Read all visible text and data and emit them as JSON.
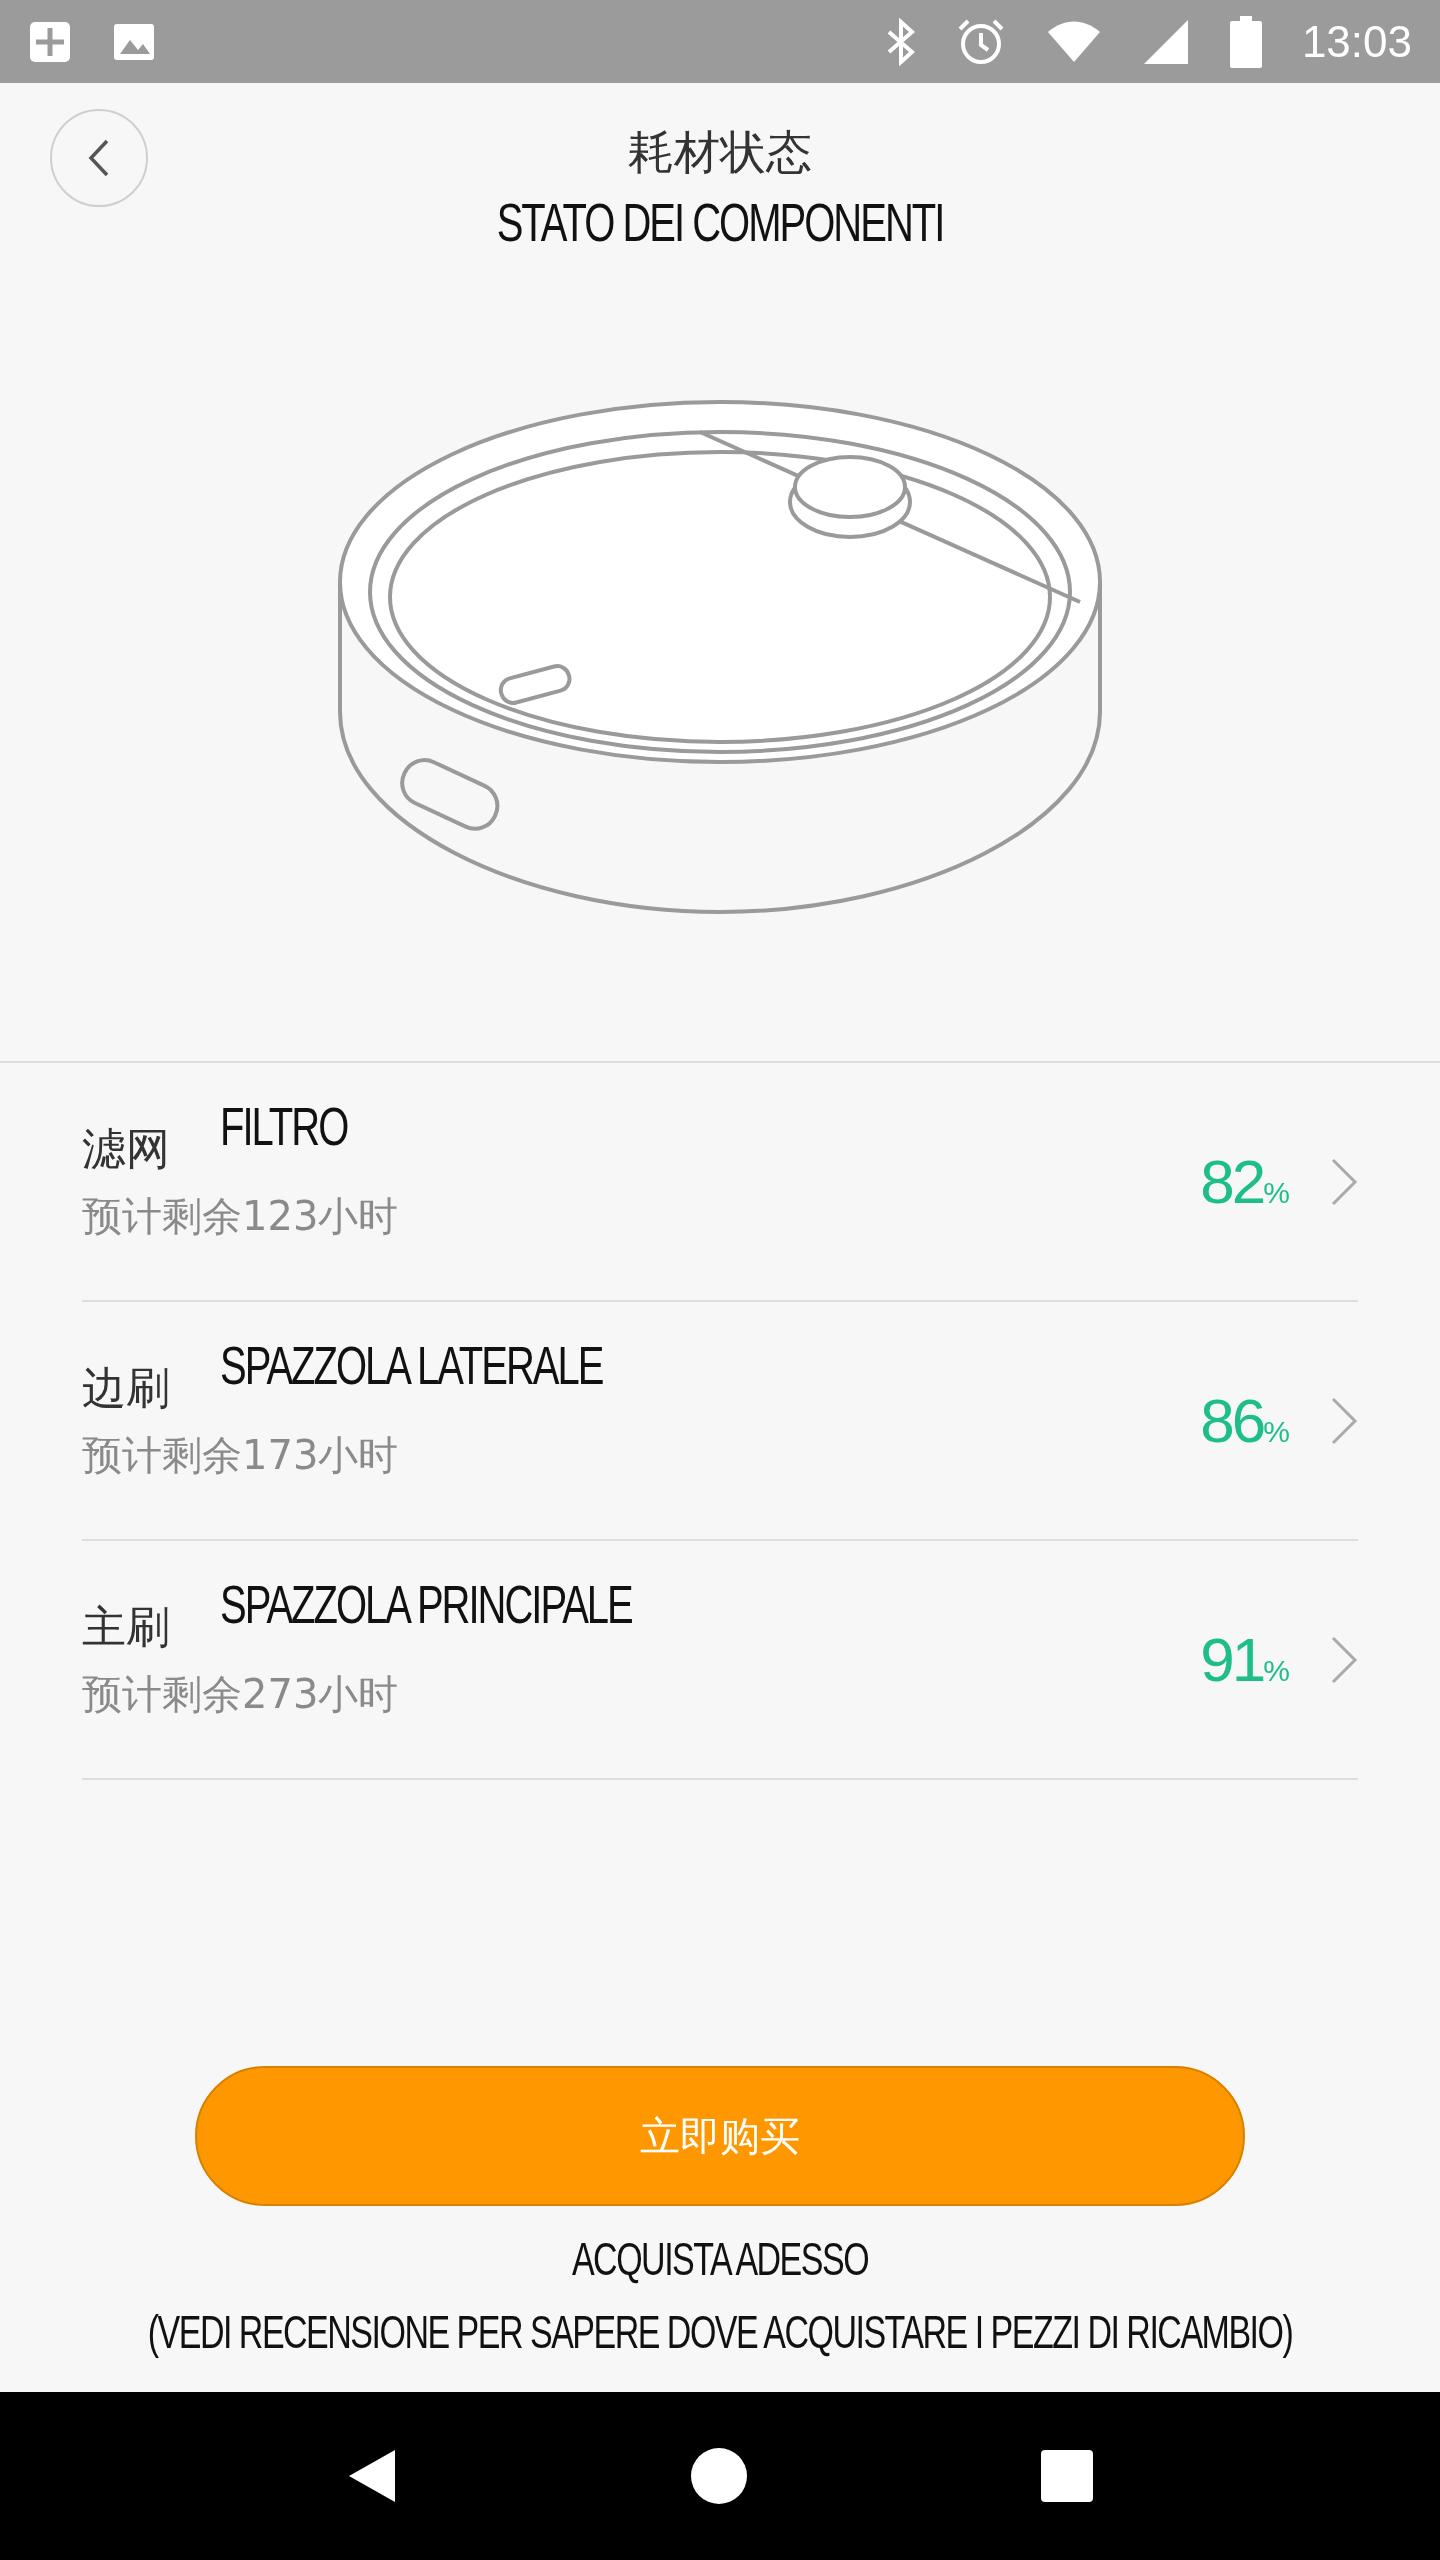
{
  "status_bar": {
    "time": "13:03"
  },
  "header": {
    "title": "耗材状态",
    "subtitle": "STATO DEI COMPONENTI"
  },
  "components": [
    {
      "name": "滤网",
      "translation": "FILTRO",
      "remaining": "预计剩余123小时",
      "value": "82",
      "unit": "%"
    },
    {
      "name": "边刷",
      "translation": "SPAZZOLA LATERALE",
      "remaining": "预计剩余173小时",
      "value": "86",
      "unit": "%"
    },
    {
      "name": "主刷",
      "translation": "SPAZZOLA PRINCIPALE",
      "remaining": "预计剩余273小时",
      "value": "91",
      "unit": "%"
    }
  ],
  "buy_button": {
    "label": "立即购买"
  },
  "notes": [
    "ACQUISTA ADESSO",
    "(VEDI RECENSIONE PER SAPERE DOVE ACQUISTARE I PEZZI DI RICAMBIO)"
  ]
}
